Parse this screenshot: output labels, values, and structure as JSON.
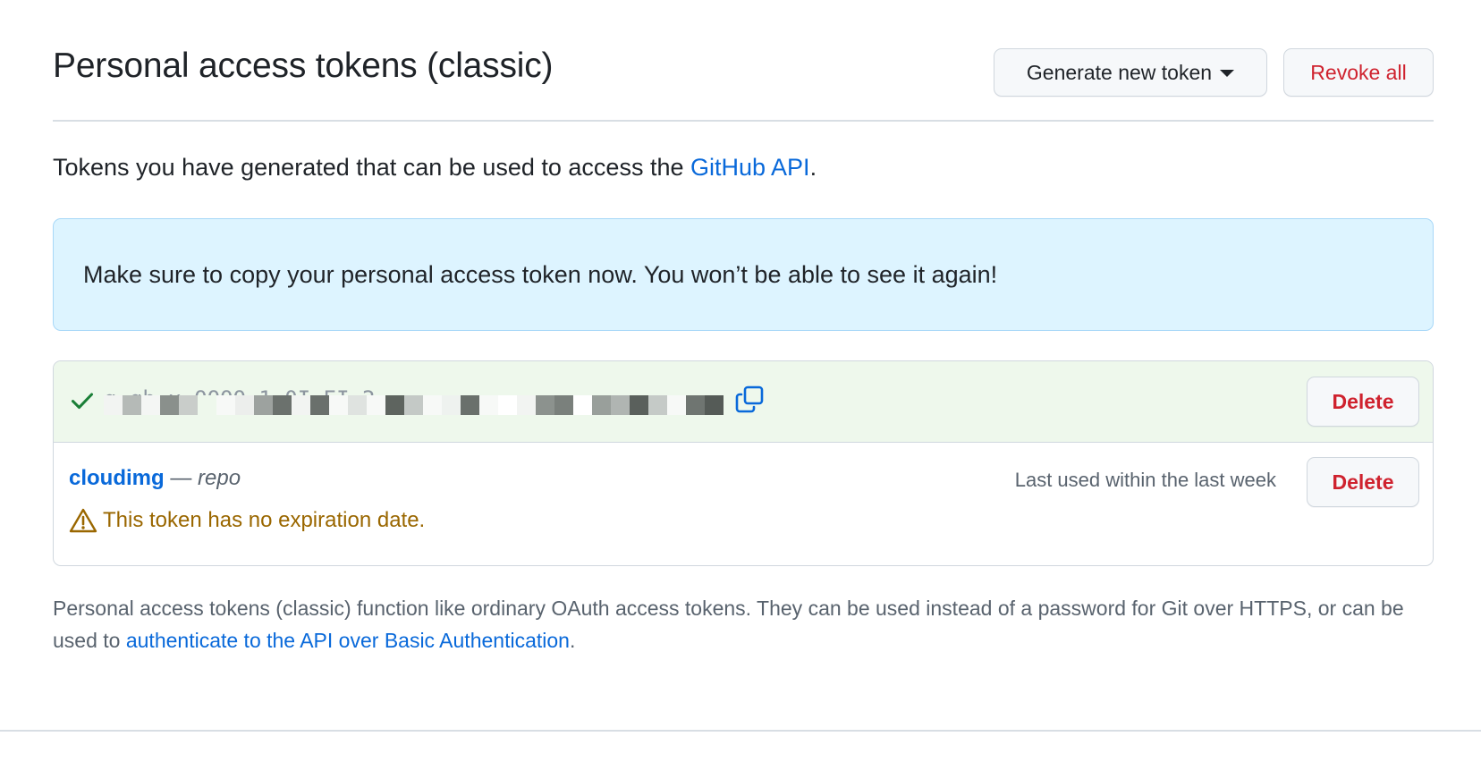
{
  "header": {
    "title": "Personal access tokens (classic)",
    "generate_label": "Generate new token",
    "revoke_label": "Revoke all"
  },
  "intro": {
    "text_before": "Tokens you have generated that can be used to access the ",
    "link": "GitHub API",
    "text_after": "."
  },
  "flash": {
    "message": "Make sure to copy your personal access token now. You won’t be able to see it again!"
  },
  "new_token": {
    "value": "g       gh   x   OOOO 1 0I  EI 2",
    "delete_label": "Delete",
    "icons": {
      "check": "check-icon",
      "copy": "copy-icon"
    }
  },
  "token": {
    "name": "cloudimg",
    "separator": " — ",
    "scope": "repo",
    "last_used": "Last used within the last week",
    "delete_label": "Delete",
    "warning": "This token has no expiration date.",
    "warning_icon": "alert-icon"
  },
  "footnote": {
    "text_before": "Personal access tokens (classic) function like ordinary OAuth access tokens. They can be used instead of a password for Git over HTTPS, or can be used to ",
    "link": "authenticate to the API over Basic Authentication",
    "text_after": "."
  },
  "colors": {
    "accent": "#0969da",
    "danger": "#cf222e",
    "success": "#1a7f37",
    "attention": "#9a6700",
    "flash_bg": "#ddf4ff",
    "new_token_bg": "#eef8ec"
  }
}
